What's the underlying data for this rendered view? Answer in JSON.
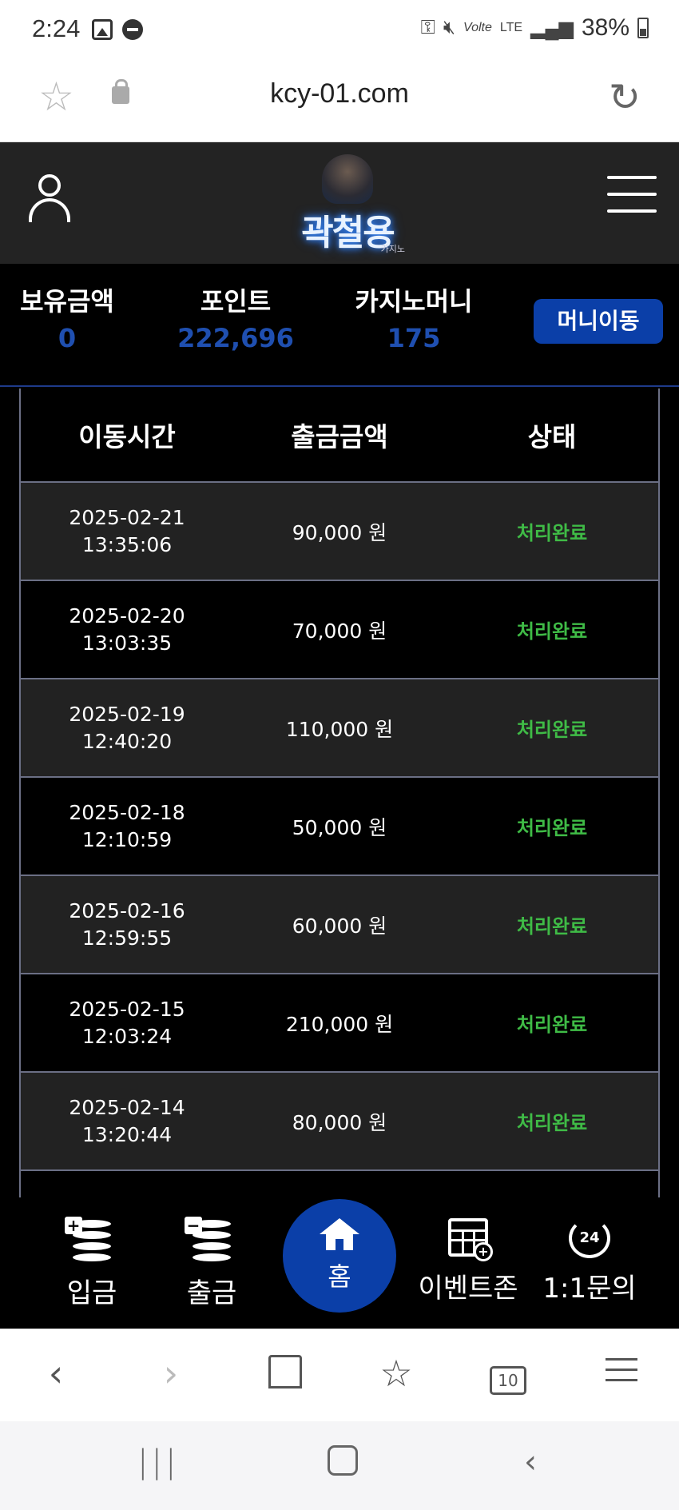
{
  "status_bar": {
    "time": "2:24",
    "lte": "LTE",
    "volte": "Volte",
    "battery": "38%"
  },
  "browser": {
    "url": "kcy-01.com"
  },
  "header": {
    "logo_text": "곽철용",
    "logo_sub": "카지노"
  },
  "balance": {
    "holding_label": "보유금액",
    "holding_value": "0",
    "points_label": "포인트",
    "points_value": "222,696",
    "casino_label": "카지노머니",
    "casino_value": "175",
    "move_button": "머니이동"
  },
  "table": {
    "headers": [
      "이동시간",
      "출금금액",
      "상태"
    ],
    "rows": [
      {
        "date": "2025-02-21",
        "time": "13:35:06",
        "amount": "90,000 원",
        "status": "처리완료"
      },
      {
        "date": "2025-02-20",
        "time": "13:03:35",
        "amount": "70,000 원",
        "status": "처리완료"
      },
      {
        "date": "2025-02-19",
        "time": "12:40:20",
        "amount": "110,000 원",
        "status": "처리완료"
      },
      {
        "date": "2025-02-18",
        "time": "12:10:59",
        "amount": "50,000 원",
        "status": "처리완료"
      },
      {
        "date": "2025-02-16",
        "time": "12:59:55",
        "amount": "60,000 원",
        "status": "처리완료"
      },
      {
        "date": "2025-02-15",
        "time": "12:03:24",
        "amount": "210,000 원",
        "status": "처리완료"
      },
      {
        "date": "2025-02-14",
        "time": "13:20:44",
        "amount": "80,000 원",
        "status": "처리완료"
      }
    ]
  },
  "bottom_nav": {
    "deposit": "입금",
    "withdraw": "출금",
    "home": "홈",
    "event": "이벤트존",
    "support": "1:1문의",
    "support_badge": "24"
  },
  "browser_toolbar": {
    "tabs_count": "10"
  },
  "colors": {
    "accent_blue": "#0b3fa8",
    "status_green": "#3fbb46",
    "value_blue": "#1f4fb0"
  }
}
